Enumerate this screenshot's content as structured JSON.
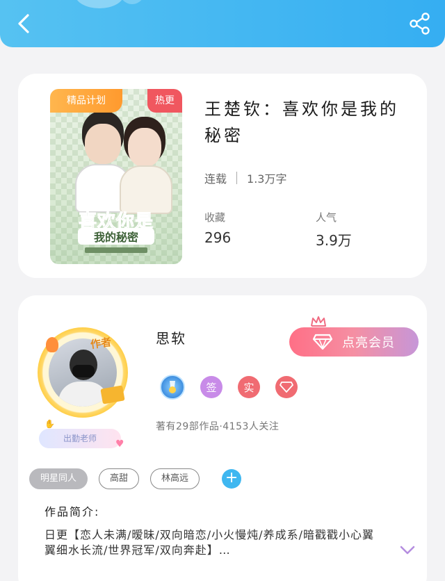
{
  "header": {
    "back_icon": "chevron-left-icon",
    "share_icon": "share-icon"
  },
  "book": {
    "cover_tag_left": "精品计划",
    "cover_tag_right": "热更",
    "cover_title_line1": "喜欢你是",
    "cover_title_line2": "我的秘密",
    "title": "王楚钦：喜欢你是我的秘密",
    "status": "连载",
    "word_count": "1.3万字",
    "stats": [
      {
        "label": "收藏",
        "value": "296"
      },
      {
        "label": "人气",
        "value": "3.9万"
      }
    ]
  },
  "author": {
    "name": "思软",
    "avatar_badge": "作者",
    "ribbon_text": "出勤老师",
    "vip_button_label": "点亮会员",
    "badges": [
      {
        "icon": "medal-icon"
      },
      {
        "icon": "signed-icon",
        "text": "签"
      },
      {
        "icon": "verified-icon",
        "text": "实"
      },
      {
        "icon": "diamond-icon"
      }
    ],
    "works_info": "著有29部作品·4153人关注"
  },
  "tags": [
    "明星同人",
    "高甜",
    "林高远"
  ],
  "intro": {
    "title": "作品简介:",
    "text": "日更【恋人未满/暧昧/双向暗恋/小火慢炖/养成系/暗戳戳小心翼翼细水长流/世界冠军/双向奔赴】…"
  },
  "colors": {
    "header_blue": "#42b7f2",
    "tag_orange": "#ff9a2e",
    "tag_red": "#f0575f",
    "vip_pink": "#ff6f86",
    "vip_purple": "#c696d8",
    "add_blue": "#3fb7f0",
    "expand_purple": "#b58ee0"
  }
}
